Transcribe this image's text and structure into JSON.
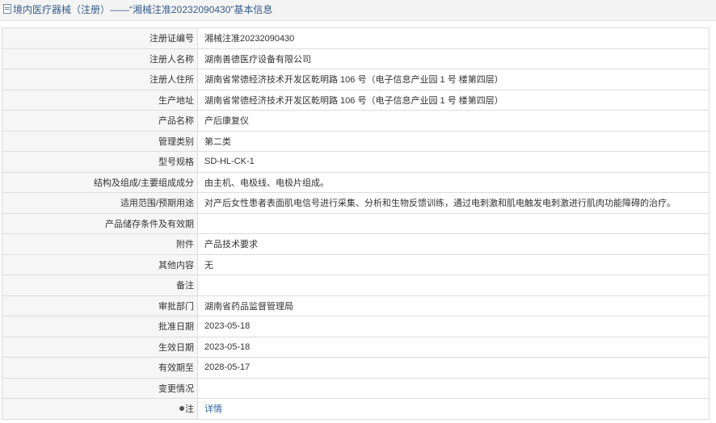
{
  "header": {
    "title": "境内医疗器械（注册）——“湘械注准20232090430”基本信息",
    "icon": "document-icon"
  },
  "rows": [
    {
      "label": "注册证编号",
      "value": "湘械注准20232090430"
    },
    {
      "label": "注册人名称",
      "value": "湖南善德医疗设备有限公司"
    },
    {
      "label": "注册人住所",
      "value": "湖南省常德经济技术开发区乾明路 106 号（电子信息产业园 1 号 楼第四层）"
    },
    {
      "label": "生产地址",
      "value": "湖南省常德经济技术开发区乾明路 106 号（电子信息产业园 1 号 楼第四层）"
    },
    {
      "label": "产品名称",
      "value": "产后康复仪"
    },
    {
      "label": "管理类别",
      "value": "第二类"
    },
    {
      "label": "型号规格",
      "value": "SD-HL-CK-1"
    },
    {
      "label": "结构及组成/主要组成成分",
      "value": "由主机、电极线、电极片组成。"
    },
    {
      "label": "适用范围/预期用途",
      "value": "对产后女性患者表面肌电信号进行采集、分析和生物反馈训练，通过电刺激和肌电触发电刺激进行肌肉功能障碍的治疗。"
    },
    {
      "label": "产品储存条件及有效期",
      "value": ""
    },
    {
      "label": "附件",
      "value": "产品技术要求"
    },
    {
      "label": "其他内容",
      "value": "无"
    },
    {
      "label": "备注",
      "value": ""
    },
    {
      "label": "审批部门",
      "value": "湖南省药品监督管理局"
    },
    {
      "label": "批准日期",
      "value": "2023-05-18"
    },
    {
      "label": "生效日期",
      "value": "2023-05-18"
    },
    {
      "label": "有效期至",
      "value": "2028-05-17"
    },
    {
      "label": "变更情况",
      "value": ""
    }
  ],
  "note_row": {
    "icon": "pin-icon",
    "label": "注",
    "link_text": "详情"
  }
}
